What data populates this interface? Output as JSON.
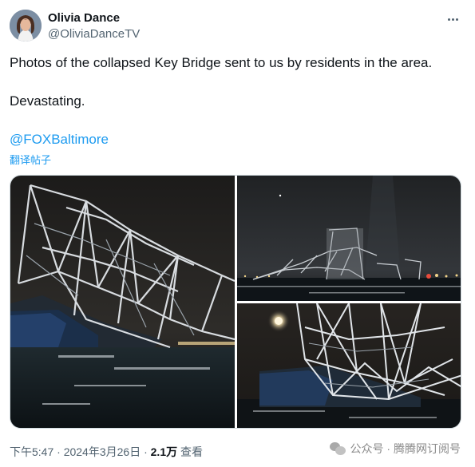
{
  "author": {
    "name": "Olivia Dance",
    "handle": "@OliviaDanceTV"
  },
  "tweet": {
    "line1": "Photos of the collapsed Key Bridge sent to us by residents in the area.",
    "line2": "Devastating.",
    "mention": "@FOXBaltimore",
    "translate": "翻译帖子"
  },
  "icons": {
    "more": "more-horizontal-icon",
    "watermark": "wechat-icon"
  },
  "footer": {
    "time": "下午5:47 · 2024年3月26日 · ",
    "views": "2.1万",
    "views_label": " 查看"
  },
  "watermark": {
    "text": "公众号 · 腾腾网订阅号"
  },
  "colors": {
    "link": "#1d9bf0",
    "text": "#0f1419",
    "muted": "#536471",
    "border": "#cfd9de"
  }
}
